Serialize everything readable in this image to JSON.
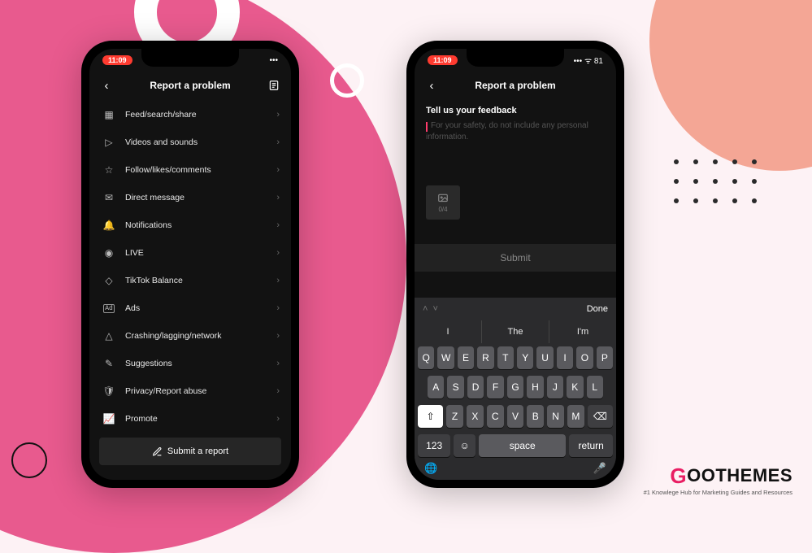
{
  "status": {
    "time": "11:09",
    "battery": "81"
  },
  "header": {
    "title": "Report a problem"
  },
  "list_items": [
    {
      "icon": "feed-icon",
      "label": "Feed/search/share"
    },
    {
      "icon": "video-icon",
      "label": "Videos and sounds"
    },
    {
      "icon": "star-icon",
      "label": "Follow/likes/comments"
    },
    {
      "icon": "message-icon",
      "label": "Direct message"
    },
    {
      "icon": "bell-icon",
      "label": "Notifications"
    },
    {
      "icon": "live-icon",
      "label": "LIVE"
    },
    {
      "icon": "balance-icon",
      "label": "TikTok Balance"
    },
    {
      "icon": "ads-icon",
      "label": "Ads"
    },
    {
      "icon": "warn-icon",
      "label": "Crashing/lagging/network"
    },
    {
      "icon": "suggest-icon",
      "label": "Suggestions"
    },
    {
      "icon": "privacy-icon",
      "label": "Privacy/Report abuse"
    },
    {
      "icon": "promote-icon",
      "label": "Promote"
    }
  ],
  "submit_bar": "Submit a report",
  "feedback": {
    "heading": "Tell us your feedback",
    "placeholder": "For your safety, do not include any personal information.",
    "attach_count": "0/4",
    "submit": "Submit"
  },
  "keyboard": {
    "done": "Done",
    "suggestions": [
      "I",
      "The",
      "I'm"
    ],
    "row1": [
      "Q",
      "W",
      "E",
      "R",
      "T",
      "Y",
      "U",
      "I",
      "O",
      "P"
    ],
    "row2": [
      "A",
      "S",
      "D",
      "F",
      "G",
      "H",
      "J",
      "K",
      "L"
    ],
    "row3": [
      "Z",
      "X",
      "C",
      "V",
      "B",
      "N",
      "M"
    ],
    "numkey": "123",
    "space": "space",
    "return": "return"
  },
  "brand": {
    "name": "OOTHEMES",
    "tagline": "#1 Knowlege Hub for Marketing Guides and Resources"
  }
}
